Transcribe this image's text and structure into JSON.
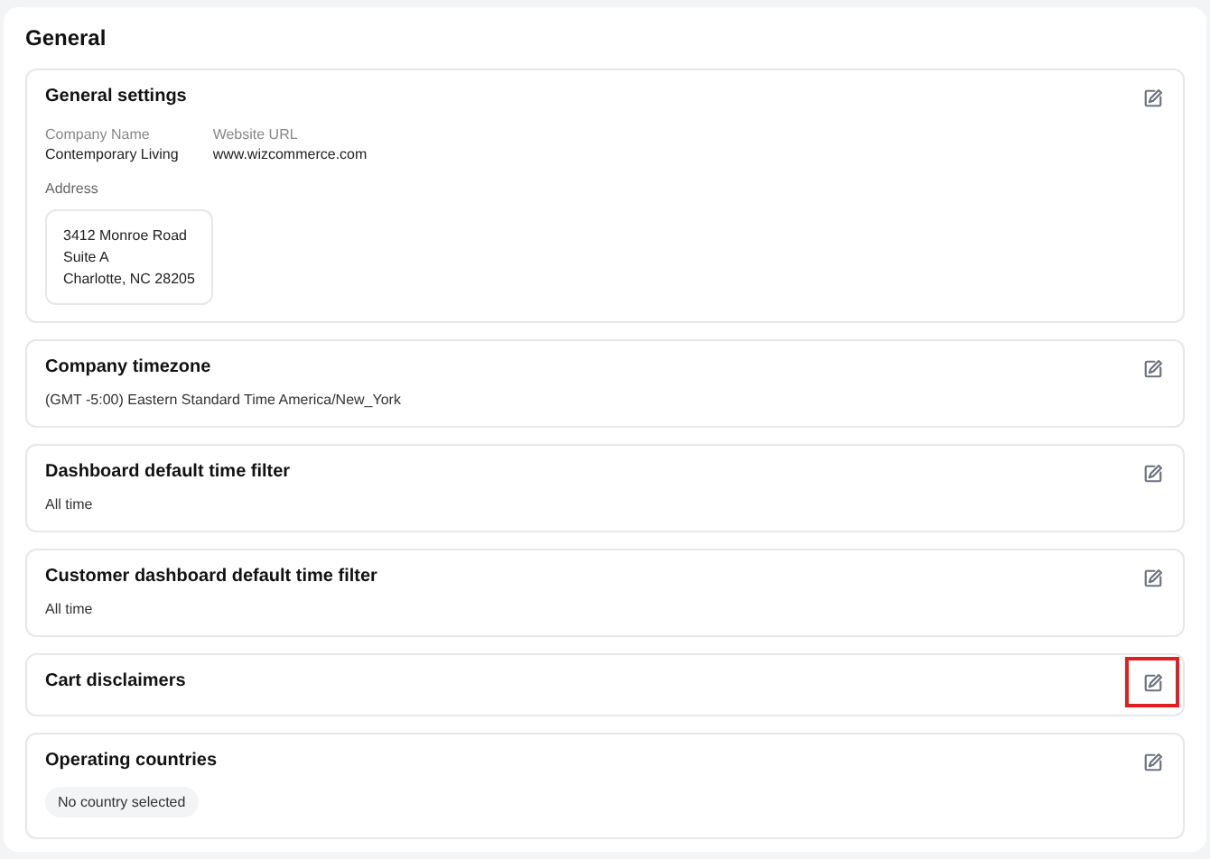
{
  "title": "General",
  "sections": [
    {
      "kind": "details",
      "title": "General settings",
      "highlighted": false,
      "fields": [
        {
          "label": "Company Name",
          "value": "Contemporary Living"
        },
        {
          "label": "Website URL",
          "value": "www.wizcommerce.com"
        }
      ],
      "address_label": "Address",
      "address_lines": [
        "3412 Monroe Road",
        "Suite A",
        "Charlotte, NC 28205"
      ]
    },
    {
      "kind": "text",
      "title": "Company timezone",
      "highlighted": false,
      "value": "(GMT -5:00) Eastern Standard Time America/New_York"
    },
    {
      "kind": "text",
      "title": "Dashboard default time filter",
      "highlighted": false,
      "value": "All time"
    },
    {
      "kind": "text",
      "title": "Customer dashboard default time filter",
      "highlighted": false,
      "value": "All time"
    },
    {
      "kind": "empty",
      "title": "Cart disclaimers",
      "highlighted": true
    },
    {
      "kind": "chip",
      "title": "Operating countries",
      "highlighted": false,
      "value": "No country selected"
    }
  ]
}
